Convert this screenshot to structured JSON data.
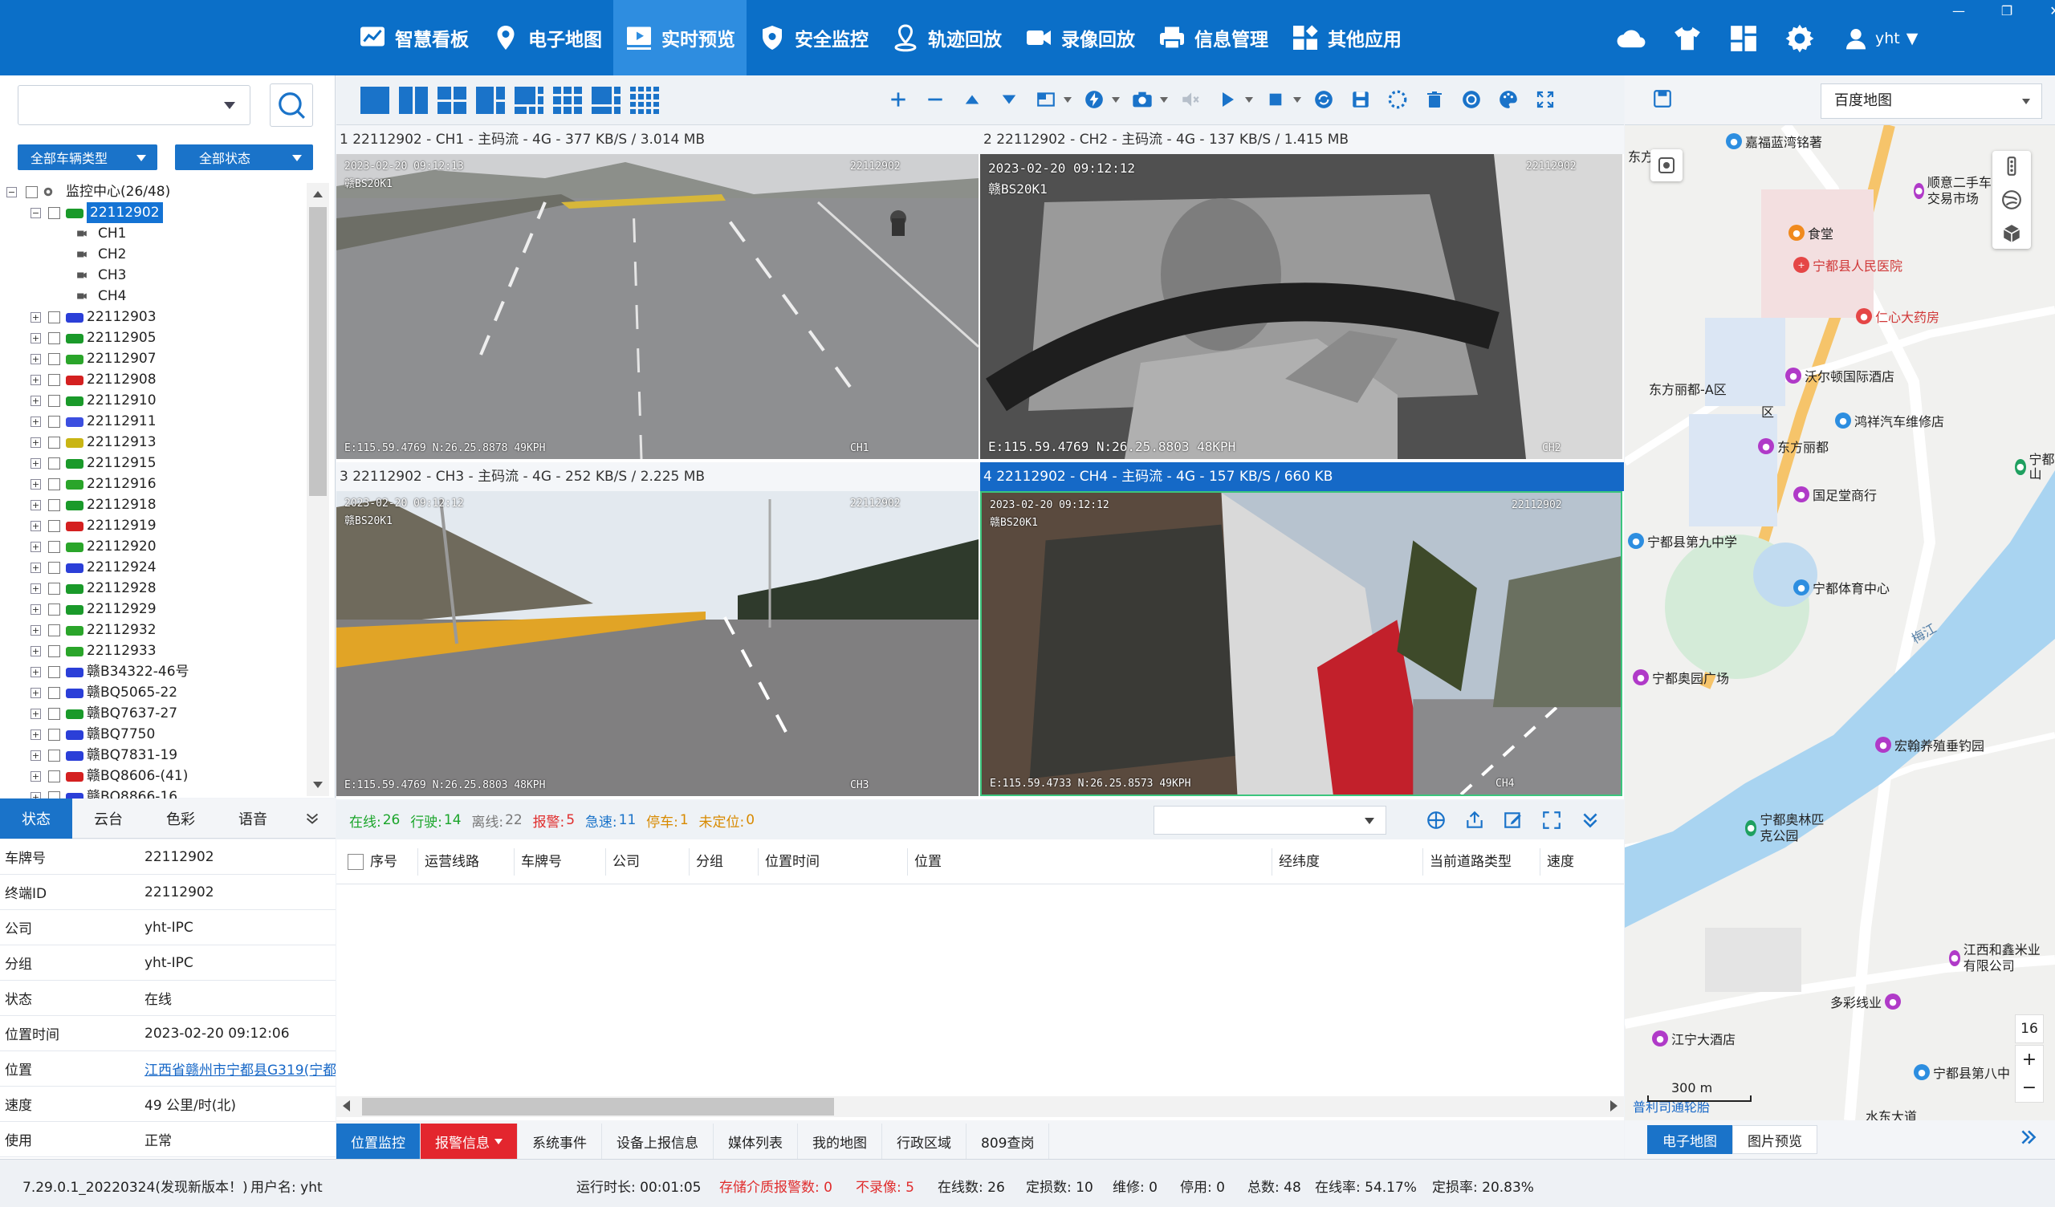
{
  "nav": {
    "items": [
      {
        "label": "智慧看板",
        "icon": "dashboard-chart-icon"
      },
      {
        "label": "电子地图",
        "icon": "map-pin-icon"
      },
      {
        "label": "实时预览",
        "icon": "play-video-icon"
      },
      {
        "label": "安全监控",
        "icon": "shield-icon"
      },
      {
        "label": "轨迹回放",
        "icon": "location-track-icon"
      },
      {
        "label": "录像回放",
        "icon": "video-camera-icon"
      },
      {
        "label": "信息管理",
        "icon": "printer-info-icon"
      },
      {
        "label": "其他应用",
        "icon": "apps-grid-icon"
      }
    ],
    "active_index": 2,
    "user": "yht"
  },
  "colors": {
    "primary": "#0b6fc8",
    "active_tab": "#2e8de0",
    "accent": "#1a73c9",
    "alarm": "#e3262e",
    "online": "#1aa52a"
  },
  "left": {
    "filter_type": "全部车辆类型",
    "filter_status": "全部状态",
    "tree": {
      "root": "监控中心(26/48)",
      "selected": "22112902",
      "channels": [
        "CH1",
        "CH2",
        "CH3",
        "CH4"
      ],
      "vehicles": [
        {
          "name": "22112903",
          "color": "#2b3fd8"
        },
        {
          "name": "22112905",
          "color": "#1a9a2a"
        },
        {
          "name": "22112907",
          "color": "#2aa52a"
        },
        {
          "name": "22112908",
          "color": "#d42020"
        },
        {
          "name": "22112910",
          "color": "#1a9a2a"
        },
        {
          "name": "22112911",
          "color": "#3c4fe0"
        },
        {
          "name": "22112913",
          "color": "#c9b514"
        },
        {
          "name": "22112915",
          "color": "#1a9a2a"
        },
        {
          "name": "22112916",
          "color": "#2aa52a"
        },
        {
          "name": "22112918",
          "color": "#1a9a2a"
        },
        {
          "name": "22112919",
          "color": "#d42020"
        },
        {
          "name": "22112920",
          "color": "#2aa52a"
        },
        {
          "name": "22112924",
          "color": "#2b3fd8"
        },
        {
          "name": "22112928",
          "color": "#1a9a2a"
        },
        {
          "name": "22112929",
          "color": "#1a9a2a"
        },
        {
          "name": "22112932",
          "color": "#2aa52a"
        },
        {
          "name": "22112933",
          "color": "#2aa52a"
        },
        {
          "name": "赣B34322-46号",
          "color": "#2b3fd8"
        },
        {
          "name": "赣BQ5065-22",
          "color": "#2b3fd8"
        },
        {
          "name": "赣BQ7637-27",
          "color": "#1a9a2a"
        },
        {
          "name": "赣BQ7750",
          "color": "#2b3fd8"
        },
        {
          "name": "赣BQ7831-19",
          "color": "#2b3fd8"
        },
        {
          "name": "赣BQ8606-(41)",
          "color": "#d42020"
        },
        {
          "name": "赣BQ8866-16",
          "color": "#2b3fd8"
        }
      ]
    },
    "tabs": [
      "状态",
      "云台",
      "色彩",
      "语音"
    ],
    "info": [
      {
        "k": "车牌号",
        "v": "22112902"
      },
      {
        "k": "终端ID",
        "v": "22112902"
      },
      {
        "k": "公司",
        "v": "yht-IPC"
      },
      {
        "k": "分组",
        "v": "yht-IPC"
      },
      {
        "k": "状态",
        "v": "在线"
      },
      {
        "k": "位置时间",
        "v": "2023-02-20 09:12:06"
      },
      {
        "k": "位置",
        "v": "江西省赣州市宁都县G319(宁都",
        "link": true
      },
      {
        "k": "速度",
        "v": "49 公里/时(北)"
      },
      {
        "k": "使用",
        "v": "正常"
      }
    ]
  },
  "videos": [
    {
      "header": "1 22112902 - CH1 - 主码流 - 4G - 377 KB/S / 3.014 MB",
      "ts": "2023-02-20 09:12:13",
      "plate": "赣BS20K1",
      "id": "22112902",
      "gps": "E:115.59.4769 N:26.25.8878 49KPH",
      "ch": "CH1"
    },
    {
      "header": "2 22112902 - CH2 - 主码流 - 4G - 137 KB/S / 1.415 MB",
      "ts": "2023-02-20 09:12:12",
      "plate": "赣BS20K1",
      "id": "22112902",
      "gps": "E:115.59.4769 N:26.25.8803 48KPH",
      "ch": "CH2"
    },
    {
      "header": "3 22112902 - CH3 - 主码流 - 4G - 252 KB/S / 2.225 MB",
      "ts": "2023-02-20 09:12:12",
      "plate": "赣BS20K1",
      "id": "22112902",
      "gps": "E:115.59.4769 N:26.25.8803 48KPH",
      "ch": "CH3"
    },
    {
      "header": "4 22112902 - CH4 - 主码流 - 4G - 157 KB/S / 660 KB",
      "ts": "2023-02-20 09:12:12",
      "plate": "赣BS20K1",
      "id": "22112902",
      "gps": "E:115.59.4733 N:26.25.8573 49KPH",
      "ch": "CH4"
    }
  ],
  "status": {
    "online_l": "在线:",
    "online": "26",
    "driving_l": "行驶:",
    "driving": "14",
    "offline_l": "离线:",
    "offline": "22",
    "alarm_l": "报警:",
    "alarm": "5",
    "speeding_l": "急速:",
    "speeding": "11",
    "parked_l": "停车:",
    "parked": "1",
    "unlocated_l": "未定位:",
    "unlocated": "0"
  },
  "table": {
    "columns": [
      "序号",
      "运营线路",
      "车牌号",
      "公司",
      "分组",
      "位置时间",
      "位置",
      "经纬度",
      "当前道路类型",
      "速度"
    ]
  },
  "bottom_tabs": [
    "位置监控",
    "报警信息",
    "系统事件",
    "设备上报信息",
    "媒体列表",
    "我的地图",
    "行政区域",
    "809查岗"
  ],
  "map": {
    "provider": "百度地图",
    "pois": [
      {
        "t": "嘉福蓝湾铭著",
        "c": "blue"
      },
      {
        "t": "顺意二手车交易市场",
        "c": ""
      },
      {
        "t": "食堂",
        "c": "org"
      },
      {
        "t": "宁都县人民医院",
        "c": "red"
      },
      {
        "t": "仁心大药房",
        "c": "red"
      },
      {
        "t": "东方丽都-A区",
        "c": "none"
      },
      {
        "t": "沃尔顿国际酒店",
        "c": ""
      },
      {
        "t": "鸿祥汽车维修店",
        "c": "blue"
      },
      {
        "t": "东方丽都",
        "c": ""
      },
      {
        "t": "国足堂商行",
        "c": ""
      },
      {
        "t": "宁都县第九中学",
        "c": "blue"
      },
      {
        "t": "宁都体育中心",
        "c": "blue"
      },
      {
        "t": "宁都奥园广场",
        "c": ""
      },
      {
        "t": "宏翰养殖垂钓园",
        "c": ""
      },
      {
        "t": "宁都奥林匹克公园",
        "c": "grn"
      },
      {
        "t": "江西和鑫米业有限公司",
        "c": ""
      },
      {
        "t": "多彩线业",
        "c": ""
      },
      {
        "t": "江宁大酒店",
        "c": ""
      },
      {
        "t": "宁都县第八中",
        "c": "blue"
      },
      {
        "t": "普利司通轮胎",
        "c": "none"
      },
      {
        "t": "水东大道",
        "c": "none"
      },
      {
        "t": "梅江",
        "c": "none"
      },
      {
        "t": "宁都山",
        "c": "grn"
      },
      {
        "t": "东方",
        "c": "none"
      },
      {
        "t": "区",
        "c": "none"
      }
    ],
    "scale": "300 m",
    "zoom": "16",
    "tabs": [
      "电子地图",
      "图片预览"
    ]
  },
  "footer": {
    "version": "7.29.0.1_20220324(发现新版本！)",
    "user": "用户名: yht",
    "runtime": "运行时长: 00:01:05",
    "storage_alarm": "存储介质报警数: 0",
    "not_recording": "不录像: 5",
    "online": "在线数: 26",
    "fixed": "定损数: 10",
    "repair": "维修: 0",
    "stopped": "停用: 0",
    "total": "总数: 48",
    "online_rate": "在线率: 54.17%",
    "fixed_rate": "定损率: 20.83%"
  }
}
